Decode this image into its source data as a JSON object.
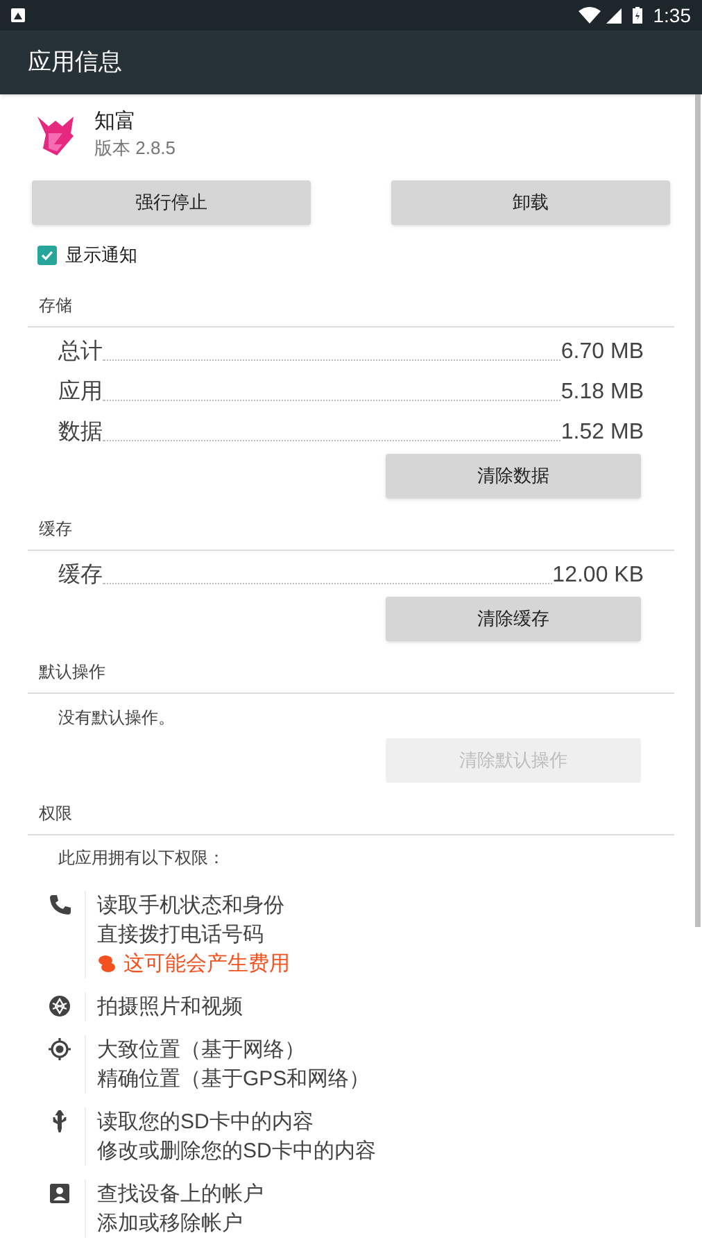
{
  "status_bar": {
    "time": "1:35"
  },
  "app_bar": {
    "title": "应用信息"
  },
  "app": {
    "name": "知富",
    "version": "版本 2.8.5"
  },
  "action_buttons": [
    {
      "label": "强行停止",
      "disabled": false
    },
    {
      "label": "卸载",
      "disabled": false
    }
  ],
  "notification_toggle": {
    "label": "显示通知",
    "checked": true
  },
  "storage": {
    "title": "存储",
    "rows": [
      {
        "label": "总计",
        "value": "6.70 MB"
      },
      {
        "label": "应用",
        "value": "5.18 MB"
      },
      {
        "label": "数据",
        "value": "1.52 MB"
      }
    ],
    "button": {
      "label": "清除数据",
      "disabled": false
    }
  },
  "cache": {
    "title": "缓存",
    "rows": [
      {
        "label": "缓存",
        "value": "12.00 KB"
      }
    ],
    "button": {
      "label": "清除缓存",
      "disabled": false
    }
  },
  "defaults": {
    "title": "默认操作",
    "message": "没有默认操作。",
    "button": {
      "label": "清除默认操作",
      "disabled": true
    }
  },
  "permissions": {
    "title": "权限",
    "intro": "此应用拥有以下权限：",
    "groups": [
      {
        "kind": "phone",
        "lines": [
          {
            "kind": "normal",
            "text": "读取手机状态和身份"
          },
          {
            "kind": "normal",
            "text": "直接拨打电话号码"
          },
          {
            "kind": "warning",
            "text": "这可能会产生费用"
          }
        ]
      },
      {
        "kind": "camera",
        "lines": [
          {
            "kind": "normal",
            "text": "拍摄照片和视频"
          }
        ]
      },
      {
        "kind": "location",
        "lines": [
          {
            "kind": "normal",
            "text": "大致位置（基于网络）"
          },
          {
            "kind": "normal",
            "text": "精确位置（基于GPS和网络）"
          }
        ]
      },
      {
        "kind": "usb",
        "lines": [
          {
            "kind": "normal",
            "text": "读取您的SD卡中的内容"
          },
          {
            "kind": "normal",
            "text": "修改或删除您的SD卡中的内容"
          }
        ]
      },
      {
        "kind": "account",
        "lines": [
          {
            "kind": "normal",
            "text": "查找设备上的帐户"
          },
          {
            "kind": "normal",
            "text": "添加或移除帐户"
          }
        ]
      }
    ]
  }
}
